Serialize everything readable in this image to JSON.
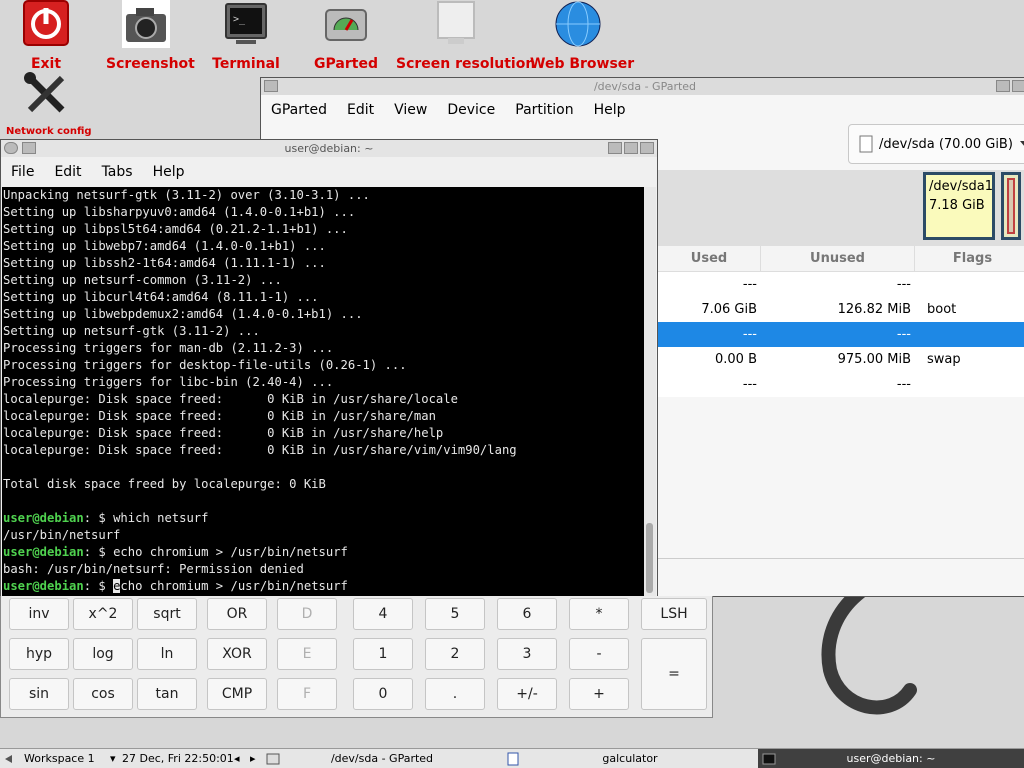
{
  "desktop": {
    "icons": [
      {
        "label": "Exit",
        "icon": "power-icon"
      },
      {
        "label": "Screenshot",
        "icon": "camera-icon"
      },
      {
        "label": "Terminal",
        "icon": "terminal-icon"
      },
      {
        "label": "GParted",
        "icon": "disk-icon"
      },
      {
        "label": "Screen resolution",
        "icon": "monitor-icon"
      },
      {
        "label": "Web Browser",
        "icon": "globe-icon"
      },
      {
        "label": "Network config",
        "icon": "tools-icon"
      }
    ]
  },
  "gparted": {
    "title": "/dev/sda - GParted",
    "menu": [
      "GParted",
      "Edit",
      "View",
      "Device",
      "Partition",
      "Help"
    ],
    "device": "/dev/sda (70.00 GiB)",
    "graph": {
      "name": "/dev/sda1",
      "size": "7.18 GiB"
    },
    "columns": [
      "Used",
      "Unused",
      "Flags"
    ],
    "rows": [
      {
        "used": "---",
        "unused": "---",
        "flags": "",
        "selected": false
      },
      {
        "used": "7.06 GiB",
        "unused": "126.82 MiB",
        "flags": "boot",
        "selected": false
      },
      {
        "used": "---",
        "unused": "---",
        "flags": "",
        "selected": true
      },
      {
        "used": "0.00 B",
        "unused": "975.00 MiB",
        "flags": "swap",
        "selected": false
      },
      {
        "used": "---",
        "unused": "---",
        "flags": "",
        "selected": false
      }
    ]
  },
  "terminal": {
    "title": "user@debian: ~",
    "menu": [
      "File",
      "Edit",
      "Tabs",
      "Help"
    ],
    "output_lines": [
      "Unpacking netsurf-gtk (3.11-2) over (3.10-3.1) ...",
      "Setting up libsharpyuv0:amd64 (1.4.0-0.1+b1) ...",
      "Setting up libpsl5t64:amd64 (0.21.2-1.1+b1) ...",
      "Setting up libwebp7:amd64 (1.4.0-0.1+b1) ...",
      "Setting up libssh2-1t64:amd64 (1.11.1-1) ...",
      "Setting up netsurf-common (3.11-2) ...",
      "Setting up libcurl4t64:amd64 (8.11.1-1) ...",
      "Setting up libwebpdemux2:amd64 (1.4.0-0.1+b1) ...",
      "Setting up netsurf-gtk (3.11-2) ...",
      "Processing triggers for man-db (2.11.2-3) ...",
      "Processing triggers for desktop-file-utils (0.26-1) ...",
      "Processing triggers for libc-bin (2.40-4) ...",
      "localepurge: Disk space freed:      0 KiB in /usr/share/locale",
      "localepurge: Disk space freed:      0 KiB in /usr/share/man",
      "localepurge: Disk space freed:      0 KiB in /usr/share/help",
      "localepurge: Disk space freed:      0 KiB in /usr/share/vim/vim90/lang",
      "",
      "Total disk space freed by localepurge: 0 KiB",
      ""
    ],
    "session": [
      {
        "prompt": "user@debian",
        "suffix": ": $ ",
        "command": "which netsurf"
      },
      {
        "output": "/usr/bin/netsurf"
      },
      {
        "prompt": "user@debian",
        "suffix": ": $ ",
        "command": "echo chromium > /usr/bin/netsurf"
      },
      {
        "output": "bash: /usr/bin/netsurf: Permission denied"
      },
      {
        "prompt": "user@debian",
        "suffix": ": $ ",
        "command_cursor": "e",
        "command_rest": "cho chromium > /usr/bin/netsurf"
      }
    ]
  },
  "calculator": {
    "buttons": [
      {
        "label": "inv",
        "enabled": true
      },
      {
        "label": "x^2",
        "enabled": true
      },
      {
        "label": "sqrt",
        "enabled": true
      },
      {
        "label": "OR",
        "enabled": true
      },
      {
        "label": "D",
        "enabled": false
      },
      {
        "label": "4",
        "enabled": true
      },
      {
        "label": "5",
        "enabled": true
      },
      {
        "label": "6",
        "enabled": true
      },
      {
        "label": "*",
        "enabled": true
      },
      {
        "label": "LSH",
        "enabled": true
      },
      {
        "label": "hyp",
        "enabled": true
      },
      {
        "label": "log",
        "enabled": true
      },
      {
        "label": "ln",
        "enabled": true
      },
      {
        "label": "XOR",
        "enabled": true
      },
      {
        "label": "E",
        "enabled": false
      },
      {
        "label": "1",
        "enabled": true
      },
      {
        "label": "2",
        "enabled": true
      },
      {
        "label": "3",
        "enabled": true
      },
      {
        "label": "-",
        "enabled": true
      },
      {
        "label": "sin",
        "enabled": true
      },
      {
        "label": "cos",
        "enabled": true
      },
      {
        "label": "tan",
        "enabled": true
      },
      {
        "label": "CMP",
        "enabled": true
      },
      {
        "label": "F",
        "enabled": false
      },
      {
        "label": "0",
        "enabled": true
      },
      {
        "label": ".",
        "enabled": true
      },
      {
        "label": "+/-",
        "enabled": true
      },
      {
        "label": "+",
        "enabled": true
      },
      {
        "label": "=",
        "enabled": true
      }
    ]
  },
  "taskbar": {
    "workspace": "Workspace 1",
    "clock": "27 Dec, Fri 22:50:01",
    "tasks": [
      "/dev/sda - GParted",
      "galculator",
      "user@debian: ~"
    ]
  }
}
